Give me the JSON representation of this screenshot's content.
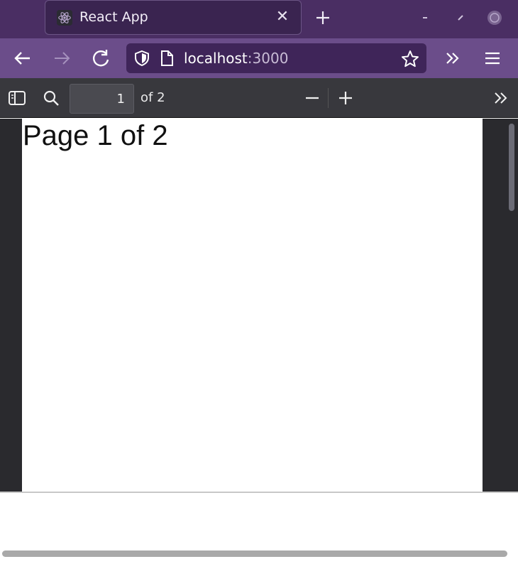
{
  "browser": {
    "tab": {
      "title": "React App",
      "favicon": "react-logo-icon",
      "close_glyph": "✕"
    },
    "new_tab_icon": "plus-icon",
    "window_controls": [
      "minimize-icon",
      "restore-icon",
      "close-icon"
    ],
    "nav": {
      "back_icon": "back-arrow-icon",
      "forward_icon": "forward-arrow-icon",
      "reload_icon": "reload-icon",
      "url_host": "localhost",
      "url_port": ":3000",
      "shield_icon": "shield-icon",
      "page_icon": "page-icon",
      "bookmark_icon": "star-icon",
      "overflow_icon": "chevron-double-right-icon",
      "menu_icon": "hamburger-menu-icon"
    },
    "colors": {
      "tabstrip": "#4a2e63",
      "navbar": "#6b4d8a",
      "urlbar": "#3f2559",
      "pdf_toolbar": "#38383d"
    }
  },
  "pdf_viewer": {
    "toolbar": {
      "sidebar_toggle_icon": "sidebar-toggle-icon",
      "search_icon": "search-icon",
      "page_number": "1",
      "page_count_label": "of 2",
      "zoom_out_icon": "minus-icon",
      "zoom_in_icon": "plus-icon",
      "tools_icon": "chevron-double-right-icon"
    },
    "page": {
      "text": "Page 1 of 2"
    }
  }
}
